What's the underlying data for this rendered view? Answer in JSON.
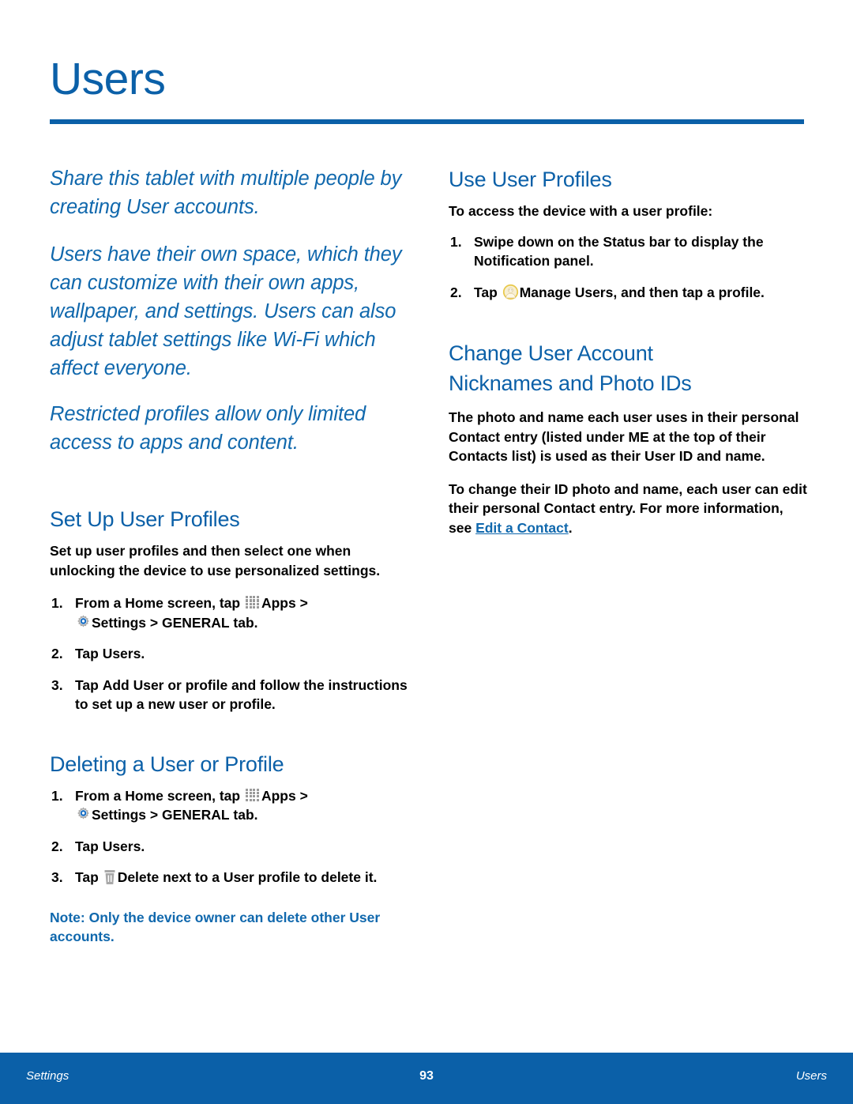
{
  "page": {
    "title": "Users"
  },
  "intro": [
    "Share this tablet with multiple people by creating User accounts.",
    "Users have their own space, which they can customize with their own apps, wallpaper, and settings. Users can also adjust tablet settings like Wi-Fi which affect everyone.",
    "Restricted profiles allow only limited access to apps and content."
  ],
  "sections": {
    "set_up": {
      "heading": "Set Up User Profiles",
      "body": "Set up user profiles and then select one when unlocking the device to use personalized settings.",
      "steps": {
        "s1_num": "1.",
        "s1_a": "From a Home screen, tap ",
        "s1_apps": "Apps",
        "s1_gt1": " > ",
        "s1_settings": "Settings",
        "s1_gt2": " > ",
        "s1_general": "GENERAL",
        "s1_tail": " tab.",
        "s2_num": "2.",
        "s2_a": "Tap ",
        "s2_users": "Users",
        "s2_tail": ".",
        "s3_num": "3.",
        "s3_a": "Tap ",
        "s3_add": "Add User or profile",
        "s3_tail": " and follow the instructions to set up a new user or profile."
      }
    },
    "deleting": {
      "heading": "Deleting a User or Profile",
      "steps": {
        "s1_num": "1.",
        "s1_a": "From a Home screen, tap ",
        "s1_apps": "Apps",
        "s1_gt1": " > ",
        "s1_settings": "Settings",
        "s1_gt2": " > ",
        "s1_general": "GENERAL",
        "s1_tail": " tab.",
        "s2_num": "2.",
        "s2_a": "Tap ",
        "s2_users": "Users",
        "s2_tail": ".",
        "s3_num": "3.",
        "s3_a": "Tap ",
        "s3_delete": "Delete",
        "s3_tail": " next to a User profile to delete it."
      },
      "note_label": "Note",
      "note_text": ": Only the device owner can delete other User accounts."
    },
    "use_profiles": {
      "heading": "Use User Profiles",
      "body": "To access the device with a user profile:",
      "steps": {
        "s1_num": "1.",
        "s1_text": "Swipe down on the Status bar to display the Notification panel.",
        "s2_num": "2.",
        "s2_a": "Tap ",
        "s2_manage": "Manage Users",
        "s2_tail": ", and then tap a profile."
      }
    },
    "change_nicknames": {
      "heading_line1": "Change User Account",
      "heading_line2": "Nicknames and Photo IDs",
      "para1": "The photo and name each user uses in their personal Contact entry (listed under ME at the top of their Contacts list) is used as their User ID and name.",
      "para2_a": "To change their ID photo and name, each user can edit their personal Contact entry. For more information, see ",
      "para2_link": "Edit a Contact",
      "para2_tail": "."
    }
  },
  "footer": {
    "left": "Settings",
    "center": "93",
    "right": "Users"
  },
  "icons": {
    "apps": "apps-grid-icon",
    "settings": "settings-gear-icon",
    "avatar": "manage-users-avatar-icon",
    "trash": "delete-trash-icon"
  },
  "colors": {
    "brand_blue": "#0b60a8",
    "link_blue": "#1068ad",
    "icon_gray": "#9a9a9a",
    "avatar_yellow": "#e8c84a"
  }
}
